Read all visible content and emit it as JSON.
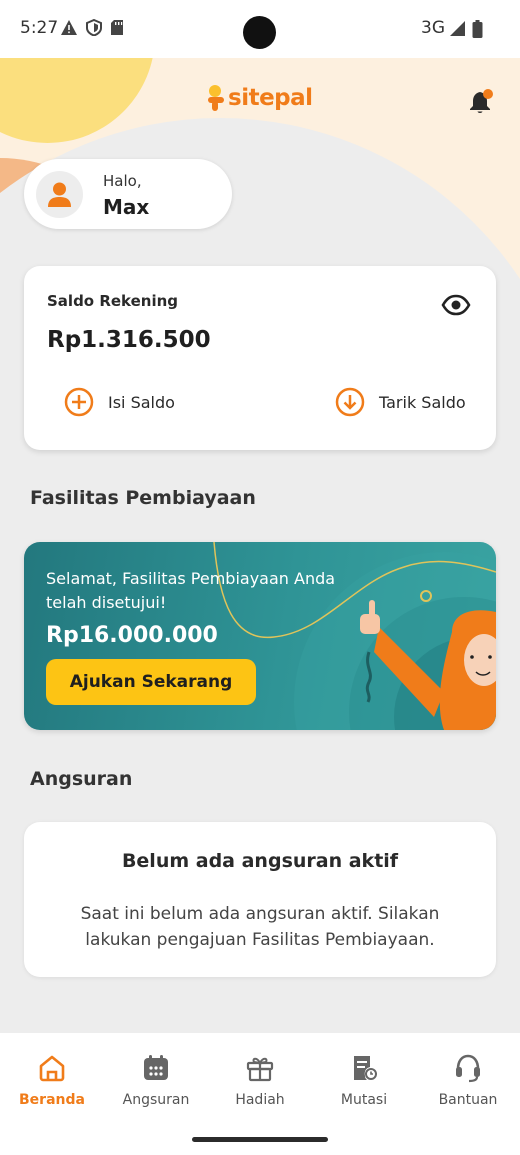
{
  "status_bar": {
    "time": "5:27",
    "network": "3G",
    "icons": [
      "warning-icon",
      "shield-icon",
      "sd-card-icon",
      "signal-icon",
      "battery-icon"
    ]
  },
  "header": {
    "logo_text": "sitepal",
    "notification_icon": "bell-icon"
  },
  "greeting": {
    "hello": "Halo,",
    "name": "Max"
  },
  "balance": {
    "label": "Saldo Rekening",
    "amount": "Rp1.316.500",
    "top_up_label": "Isi Saldo",
    "withdraw_label": "Tarik Saldo"
  },
  "financing": {
    "section_title": "Fasilitas Pembiayaan",
    "promo_text": "Selamat, Fasilitas Pembiayaan Anda telah disetujui!",
    "promo_amount": "Rp16.000.000",
    "cta_label": "Ajukan Sekarang"
  },
  "installments": {
    "section_title": "Angsuran",
    "empty_title": "Belum ada angsuran aktif",
    "empty_desc": "Saat ini belum ada angsuran aktif. Silakan lakukan pengajuan Fasilitas Pembiayaan."
  },
  "bottom_nav": {
    "items": [
      {
        "label": "Beranda",
        "icon": "home-icon",
        "active": true
      },
      {
        "label": "Angsuran",
        "icon": "calendar-icon",
        "active": false
      },
      {
        "label": "Hadiah",
        "icon": "gift-icon",
        "active": false
      },
      {
        "label": "Mutasi",
        "icon": "document-icon",
        "active": false
      },
      {
        "label": "Bantuan",
        "icon": "headset-icon",
        "active": false
      }
    ]
  },
  "colors": {
    "brand_orange": "#f07c1a",
    "teal": "#2f9496",
    "cta_yellow": "#fdc414"
  }
}
